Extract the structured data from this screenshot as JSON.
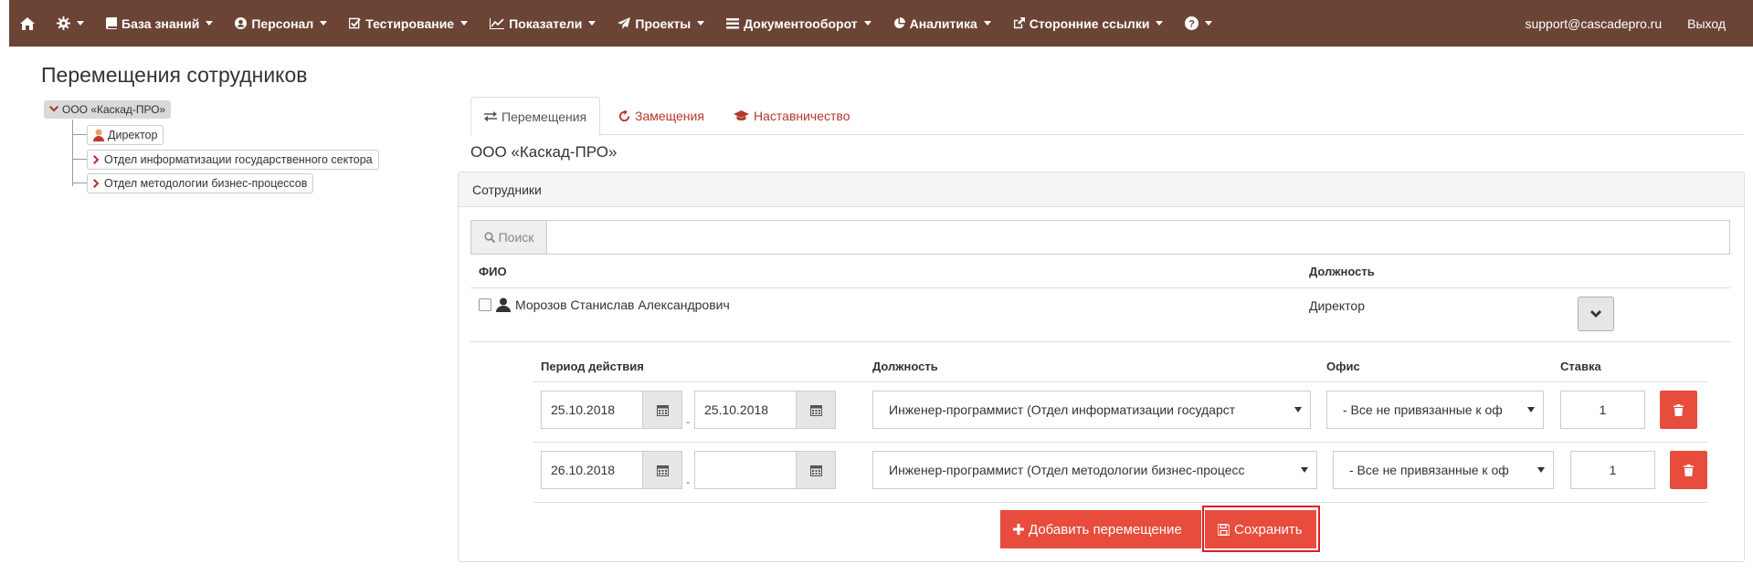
{
  "nav": {
    "items": [
      {
        "label": "База знаний",
        "icon": "book-icon"
      },
      {
        "label": "Персонал",
        "icon": "user-circle-icon"
      },
      {
        "label": "Тестирование",
        "icon": "checkbox-icon"
      },
      {
        "label": "Показатели",
        "icon": "line-chart-icon"
      },
      {
        "label": "Проекты",
        "icon": "paper-plane-icon"
      },
      {
        "label": "Документооборот",
        "icon": "list-icon"
      },
      {
        "label": "Аналитика",
        "icon": "pie-chart-icon"
      },
      {
        "label": "Сторонние ссылки",
        "icon": "external-link-icon"
      }
    ],
    "email": "support@cascadepro.ru",
    "logout": "Выход"
  },
  "page": {
    "title": "Перемещения сотрудников"
  },
  "tree": {
    "root": "ООО «Каскад-ПРО»",
    "children": [
      {
        "label": "Директор",
        "icon": "person-icon"
      },
      {
        "label": "Отдел информатизации государственного сектора",
        "icon": "chevron-right-icon"
      },
      {
        "label": "Отдел методологии бизнес-процессов",
        "icon": "chevron-right-icon"
      }
    ]
  },
  "tabs": [
    {
      "label": "Перемещения",
      "active": true
    },
    {
      "label": "Замещения",
      "active": false
    },
    {
      "label": "Наставничество",
      "active": false
    }
  ],
  "org_title": "ООО «Каскад-ПРО»",
  "panel": {
    "heading": "Сотрудники",
    "search_label": "Поиск",
    "search_value": "",
    "col_fio": "ФИО",
    "col_position": "Должность",
    "employee": {
      "name": "Морозов Станислав Александрович",
      "position": "Директор"
    }
  },
  "moves": {
    "col_period": "Период действия",
    "col_position": "Должность",
    "col_office": "Офис",
    "col_rate": "Ставка",
    "rows": [
      {
        "from": "25.10.2018",
        "to": "25.10.2018",
        "position": "Инженер-программист (Отдел информатизации государст",
        "office": "- Все не привязанные к оф",
        "rate": "1"
      },
      {
        "from": "26.10.2018",
        "to": "",
        "position": "Инженер-программист (Отдел методологии бизнес-процесс",
        "office": "- Все не привязанные к оф",
        "rate": "1"
      }
    ],
    "add_label": "Добавить перемещение",
    "save_label": "Сохранить"
  },
  "colors": {
    "navbar": "#6b4436",
    "accent": "#e74c3c",
    "tab_link": "#b5382b"
  }
}
